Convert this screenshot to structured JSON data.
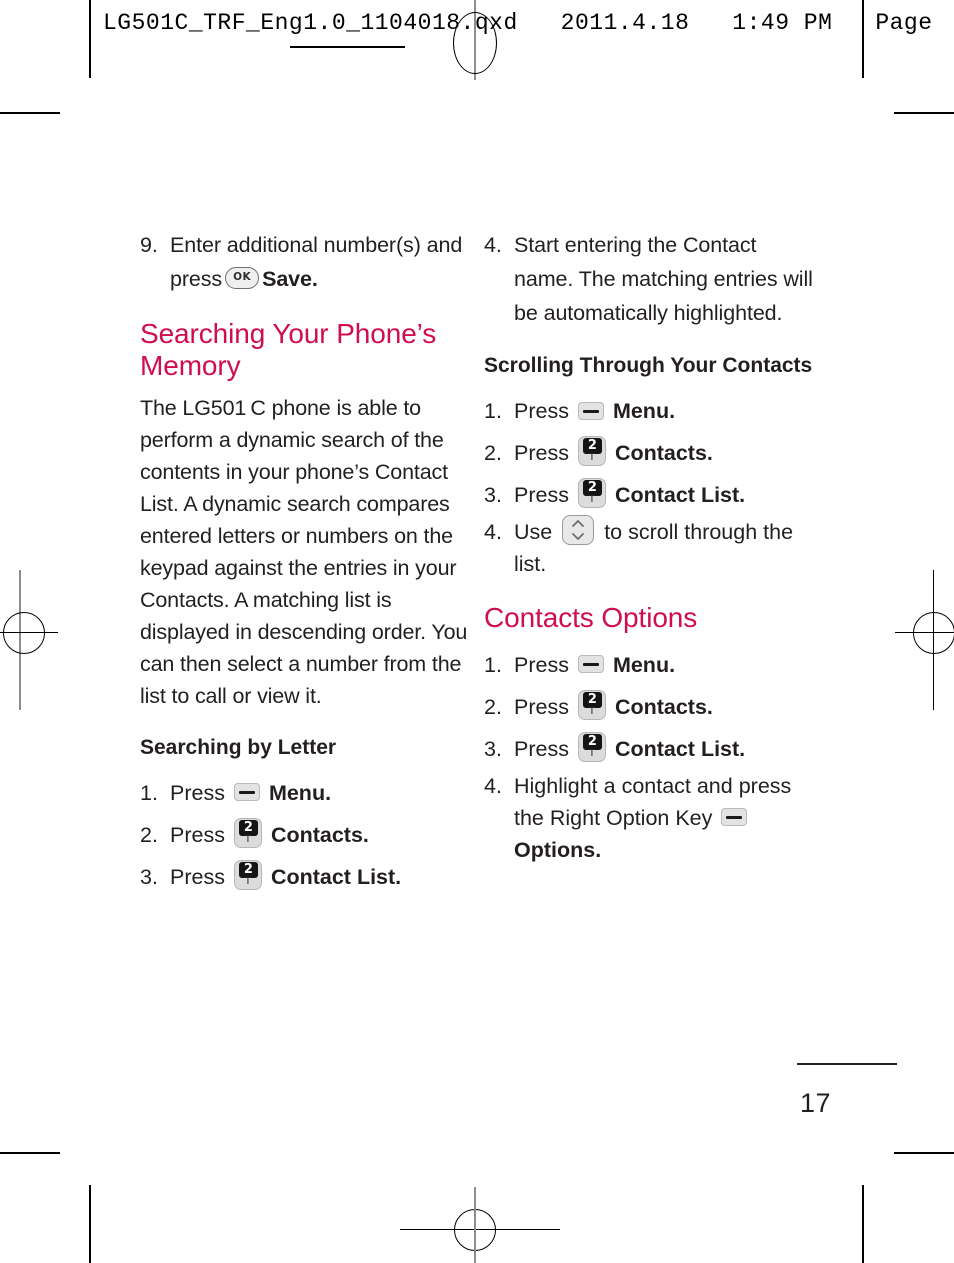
{
  "header": {
    "filename_line": "LG501C_TRF_Eng1.0_1104018.qxd   2011.4.18   1:49 PM   Page"
  },
  "colors": {
    "accent_heading": "#d00d4e",
    "body_text": "#231f20",
    "key_face": "#dcdcdc",
    "key_digit_bg": "#141414"
  },
  "left_column": {
    "step9": {
      "number": "9.",
      "text_before_key": "Enter additional number(s) and press",
      "key": {
        "name": "ok-key",
        "label": "OK"
      },
      "text_after_key": "Save."
    },
    "heading_memory": "Searching Your Phone’s Memory",
    "paragraph": "The LG501 C phone is able to perform a dynamic search of the contents in your phone’s Contact List. A dynamic search compares entered letters or numbers on the keypad against the entries in your Contacts. A matching list is displayed in descending order. You can then select a number from the list to call or view it.",
    "heading_searching_by_letter": "Searching by Letter",
    "steps": [
      {
        "number": "1.",
        "verb": "Press",
        "key": "soft-key",
        "label": "Menu."
      },
      {
        "number": "2.",
        "verb": "Press",
        "key": "num2-key",
        "label": "Contacts."
      },
      {
        "number": "3.",
        "verb": "Press",
        "key": "num2-key",
        "label": "Contact List."
      }
    ]
  },
  "right_column": {
    "step4": {
      "number": "4.",
      "text": "Start entering the Contact name. The matching entries will be automatically highlighted."
    },
    "heading_scrolling": "Scrolling Through Your Contacts",
    "scrolling_steps": [
      {
        "number": "1.",
        "verb": "Press",
        "key": "soft-key",
        "label": "Menu."
      },
      {
        "number": "2.",
        "verb": "Press",
        "key": "num2-key",
        "label": "Contacts."
      },
      {
        "number": "3.",
        "verb": "Press",
        "key": "num2-key",
        "label": "Contact List."
      }
    ],
    "scroll_step4": {
      "number": "4.",
      "verb": "Use",
      "key": "scroll-key",
      "text_after": "to scroll through the list."
    },
    "heading_contacts_options": "Contacts Options",
    "options_steps": [
      {
        "number": "1.",
        "verb": "Press",
        "key": "soft-key",
        "label": "Menu."
      },
      {
        "number": "2.",
        "verb": "Press",
        "key": "num2-key",
        "label": "Contacts."
      },
      {
        "number": "3.",
        "verb": "Press",
        "key": "num2-key",
        "label": "Contact List."
      }
    ],
    "options_step4": {
      "number": "4.",
      "text": "Highlight a contact and press the Right Option Key",
      "key": "soft-key",
      "label": "Options."
    }
  },
  "keys": {
    "num2_digit": "2",
    "num2_sub": "T",
    "ok_label": "OK"
  },
  "footer": {
    "page_number": "17"
  }
}
